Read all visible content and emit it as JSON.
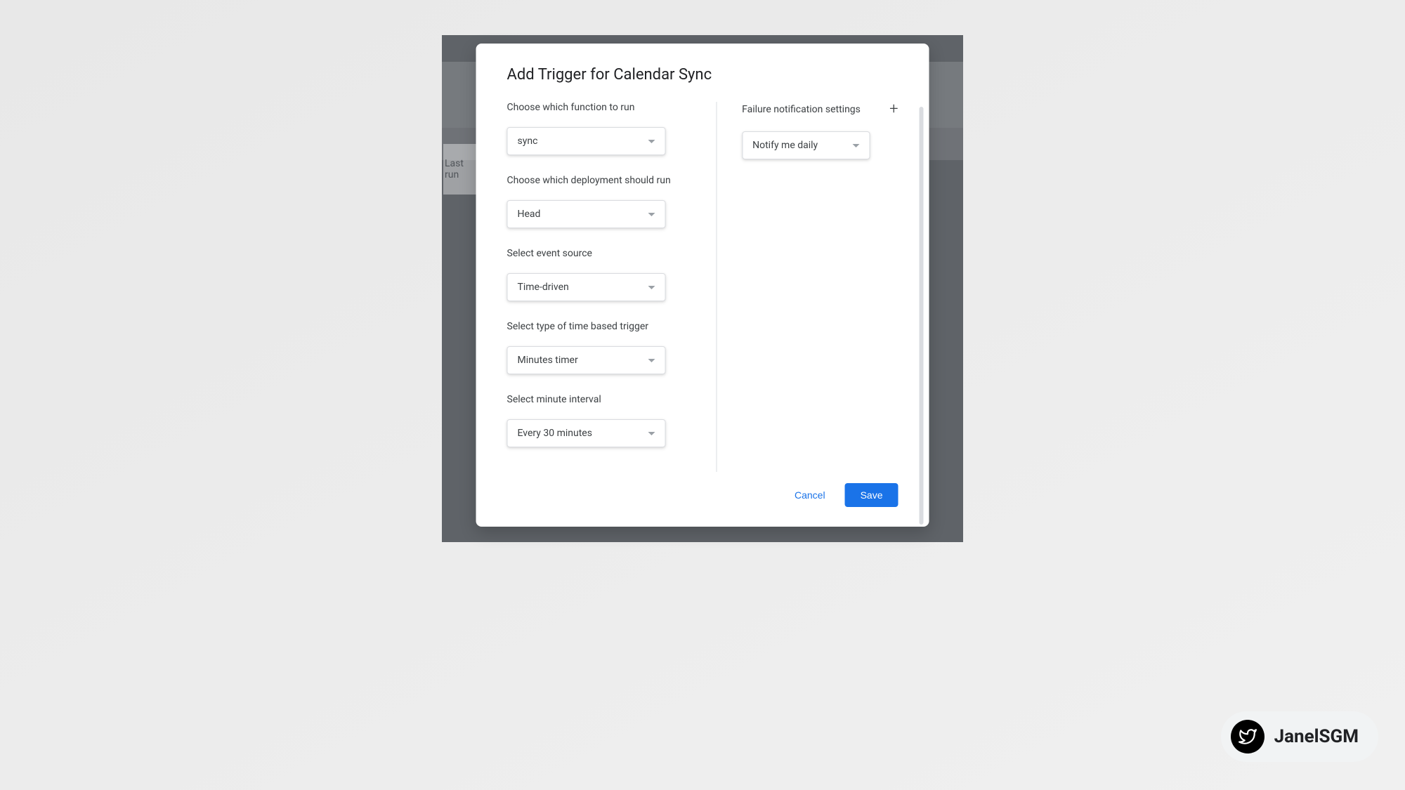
{
  "backdrop": {
    "last_run": "Last run"
  },
  "modal": {
    "title": "Add Trigger for Calendar Sync",
    "left": {
      "function": {
        "label": "Choose which function to run",
        "value": "sync"
      },
      "deployment": {
        "label": "Choose which deployment should run",
        "value": "Head"
      },
      "event_source": {
        "label": "Select event source",
        "value": "Time-driven"
      },
      "trigger_type": {
        "label": "Select type of time based trigger",
        "value": "Minutes timer"
      },
      "interval": {
        "label": "Select minute interval",
        "value": "Every 30 minutes"
      }
    },
    "right": {
      "notification": {
        "label": "Failure notification settings",
        "value": "Notify me daily"
      }
    },
    "footer": {
      "cancel": "Cancel",
      "save": "Save"
    }
  },
  "watermark": {
    "name": "JanelSGM"
  }
}
